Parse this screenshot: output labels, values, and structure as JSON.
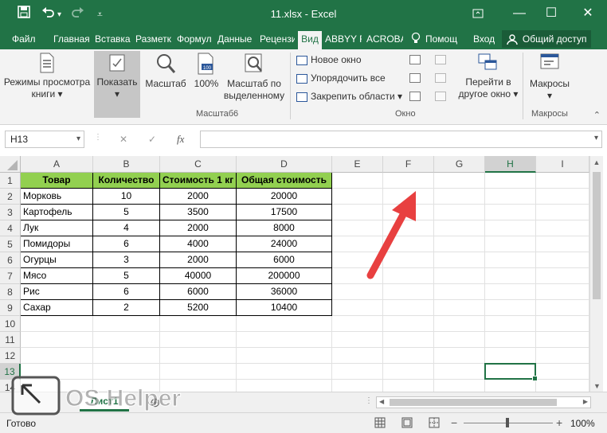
{
  "window": {
    "title": "11.xlsx - Excel"
  },
  "tabs": [
    {
      "label": "Файл",
      "active": false
    },
    {
      "label": "Главная",
      "active": false
    },
    {
      "label": "Вставка",
      "active": false
    },
    {
      "label": "Разметк",
      "active": false
    },
    {
      "label": "Формул",
      "active": false
    },
    {
      "label": "Данные",
      "active": false
    },
    {
      "label": "Рецензи",
      "active": false
    },
    {
      "label": "Вид",
      "active": true
    },
    {
      "label": "ABBYY F",
      "active": false
    },
    {
      "label": "ACROBA",
      "active": false
    },
    {
      "label": "Помощ",
      "active": false
    },
    {
      "label": "Вход",
      "active": false
    }
  ],
  "share_label": "Общий доступ",
  "ribbon": {
    "view_modes": "Режимы просмотра книги",
    "show": "Показать",
    "zoom": "Масштаб",
    "zoom100": "100%",
    "zoom_sel": "Масштаб по выделенному",
    "group_zoom": "Масштаб6",
    "new_window": "Новое окно",
    "arrange_all": "Упорядочить все",
    "freeze": "Закрепить области",
    "group_window": "Окно",
    "switch_windows": "Перейти в другое окно",
    "macros": "Макросы",
    "group_macros": "Макросы"
  },
  "formula_bar": {
    "name_box": "H13",
    "fx": "fx",
    "cancel": "✕",
    "enter": "✓",
    "value": ""
  },
  "columns": [
    "A",
    "B",
    "C",
    "D",
    "E",
    "F",
    "G",
    "H",
    "I"
  ],
  "selected_column": "H",
  "rows": [
    "1",
    "2",
    "3",
    "4",
    "5",
    "6",
    "7",
    "8",
    "9",
    "10",
    "11",
    "12",
    "13",
    "14"
  ],
  "selected_row": "13",
  "table": {
    "header": [
      "Товар",
      "Количество",
      "Стоимость 1 кг",
      "Общая стоимость"
    ],
    "data": [
      [
        "Морковь",
        "10",
        "2000",
        "20000"
      ],
      [
        "Картофель",
        "5",
        "3500",
        "17500"
      ],
      [
        "Лук",
        "4",
        "2000",
        "8000"
      ],
      [
        "Помидоры",
        "6",
        "4000",
        "24000"
      ],
      [
        "Огурцы",
        "3",
        "2000",
        "6000"
      ],
      [
        "Мясо",
        "5",
        "40000",
        "200000"
      ],
      [
        "Рис",
        "6",
        "6000",
        "36000"
      ],
      [
        "Сахар",
        "2",
        "5200",
        "10400"
      ]
    ]
  },
  "sheet_tab": "Лист1",
  "status": {
    "ready": "Готово",
    "zoom": "100%"
  },
  "watermark": "OS Helper",
  "colors": {
    "excel_green": "#217346",
    "header_fill": "#92d050",
    "arrow": "#e84040"
  }
}
